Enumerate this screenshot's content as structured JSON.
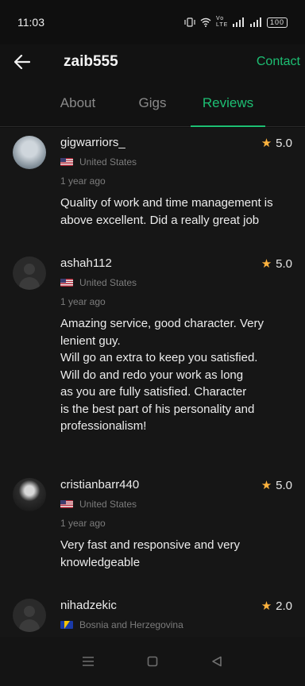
{
  "status_bar": {
    "time": "11:03",
    "network_label": "Vo LTE",
    "battery": "100"
  },
  "header": {
    "username": "zaib555",
    "contact_label": "Contact"
  },
  "tabs": [
    {
      "label": "About"
    },
    {
      "label": "Gigs"
    },
    {
      "label": "Reviews",
      "active": true
    }
  ],
  "colors": {
    "accent": "#1dbf73",
    "star": "#ffb33e",
    "background": "#161616"
  },
  "reviews": [
    {
      "username": "gigwarriors_",
      "rating": "5.0",
      "country": "United States",
      "flag": "us-flag",
      "time_ago": "1 year ago",
      "text": "Quality of work and time management is above excellent. Did a really great job"
    },
    {
      "username": "ashah112",
      "rating": "5.0",
      "country": "United States",
      "flag": "us-flag",
      "time_ago": "1 year ago",
      "text": "Amazing service, good character. Very lenient guy.\nWill go an extra to keep you satisfied.\nWill do and redo your work as long\nas you are fully satisfied. Character\nis the best part of his personality and\nprofessionalism!"
    },
    {
      "username": "cristianbarr440",
      "rating": "5.0",
      "country": "United States",
      "flag": "us-flag",
      "time_ago": "1 year ago",
      "text": "Very fast and responsive and very knowledgeable"
    },
    {
      "username": "nihadzekic",
      "rating": "2.0",
      "country": "Bosnia and Herzegovina",
      "flag": "ba-flag",
      "time_ago": "",
      "text": ""
    }
  ]
}
